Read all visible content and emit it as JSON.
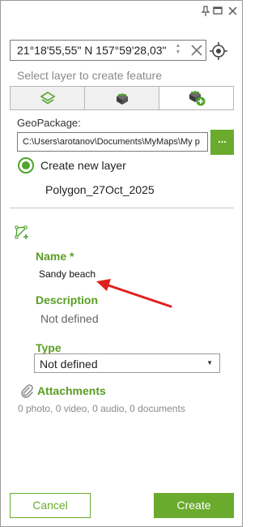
{
  "window": {
    "icons": [
      "pin-icon",
      "maximize-icon",
      "close-icon"
    ]
  },
  "coordinates": {
    "value": "21°18'55,55\" N 157°59'28,03\""
  },
  "hint": "Select layer to create feature",
  "layer_tabs": {
    "icons": [
      "layers-icon",
      "existing-layer-icon",
      "new-layer-icon"
    ]
  },
  "geopackage": {
    "label": "GeoPackage:",
    "path": "C:\\Users\\arotanov\\Documents\\MyMaps\\My p",
    "browse_label": "..."
  },
  "new_layer": {
    "option_label": "Create new layer",
    "layer_name": "Polygon_27Oct_2025"
  },
  "form": {
    "name_label": "Name *",
    "name_value": "Sandy beach",
    "description_label": "Description",
    "description_value": "Not defined",
    "type_label": "Type",
    "type_value": "Not defined",
    "attachments_label": "Attachments",
    "attachments_summary": "0 photo, 0 video, 0 audio, 0 documents"
  },
  "buttons": {
    "cancel": "Cancel",
    "create": "Create"
  },
  "colors": {
    "accent": "#6aab2e",
    "label_green": "#5a9e24",
    "annotation_arrow": "#e0201e"
  }
}
